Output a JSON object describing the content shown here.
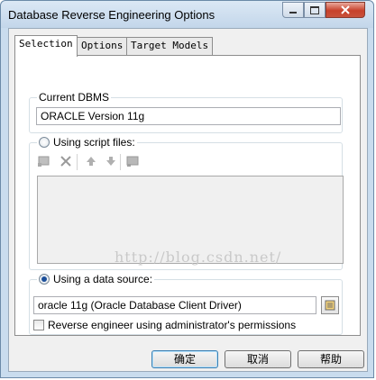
{
  "window": {
    "title": "Database Reverse Engineering Options",
    "controls": {
      "minimize": "minimize-icon",
      "maximize": "maximize-icon",
      "close": "close-icon"
    }
  },
  "tabs": [
    {
      "label": "Selection",
      "active": true
    },
    {
      "label": "Options",
      "active": false
    },
    {
      "label": "Target Models",
      "active": false
    }
  ],
  "current_dbms": {
    "label": "Current DBMS",
    "value": "ORACLE Version 11g"
  },
  "script_files": {
    "label": "Using script files:",
    "selected": false,
    "toolbar": [
      "add-file-icon",
      "delete-icon",
      "move-up-icon",
      "move-down-icon",
      "folder-icon"
    ]
  },
  "watermark": "http://blog.csdn.net/",
  "data_source": {
    "label": "Using a data source:",
    "selected": true,
    "value": "oracle 11g (Oracle Database Client Driver)",
    "browse_icon": "browse-datasource-icon"
  },
  "admin_permissions": {
    "label": "Reverse engineer using administrator's permissions",
    "checked": false
  },
  "buttons": {
    "ok": "确定",
    "cancel": "取消",
    "help": "帮助"
  }
}
